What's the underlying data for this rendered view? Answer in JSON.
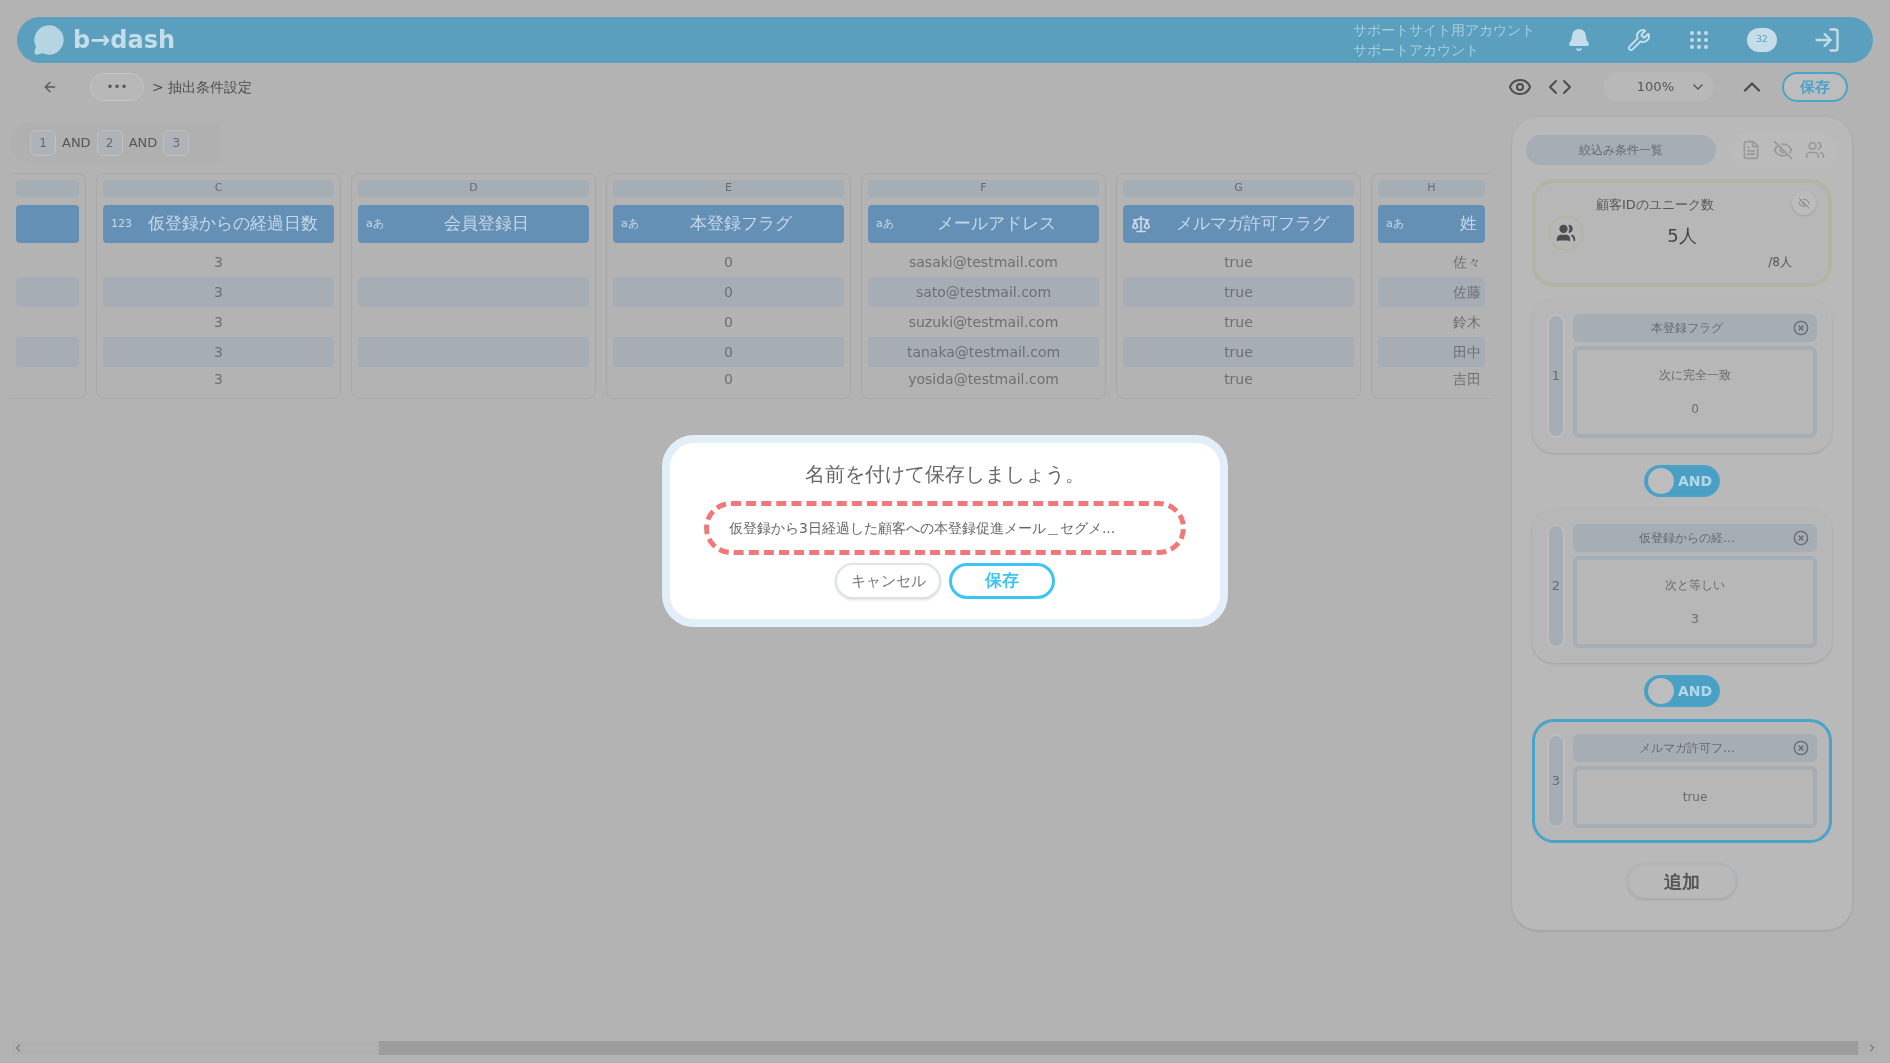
{
  "header": {
    "logo": "b→dash",
    "account_lines": [
      "サポートサイト用アカウント",
      "サポートアカウント"
    ],
    "badge": "32"
  },
  "toolbar": {
    "more": "•••",
    "breadcrumb": "> 抽出条件設定",
    "zoom": "100%",
    "save": "保存"
  },
  "filter_chips": [
    {
      "kind": "number",
      "label": "1"
    },
    {
      "kind": "op",
      "label": "AND"
    },
    {
      "kind": "number",
      "label": "2"
    },
    {
      "kind": "op",
      "label": "AND"
    },
    {
      "kind": "number",
      "label": "3"
    }
  ],
  "columns": [
    {
      "kind": "blank",
      "cells": [
        null,
        null,
        null,
        null,
        null
      ]
    },
    {
      "letter": "C",
      "kind": "number",
      "name": "仮登録からの経過日数",
      "type_label": "123",
      "cells": [
        "3",
        "3",
        "3",
        "3",
        "3"
      ]
    },
    {
      "letter": "D",
      "kind": "text",
      "name": "会員登録日",
      "type_label": "aあ",
      "cells": [
        null,
        null,
        null,
        null,
        null
      ]
    },
    {
      "letter": "E",
      "kind": "text",
      "name": "本登録フラグ",
      "type_label": "aあ",
      "cells": [
        "0",
        "0",
        "0",
        "0",
        "0"
      ]
    },
    {
      "letter": "F",
      "kind": "text",
      "name": "メールアドレス",
      "type_label": "aあ",
      "cells": [
        "sasaki@testmail.com",
        "sato@testmail.com",
        "suzuki@testmail.com",
        "tanaka@testmail.com",
        "yosida@testmail.com"
      ]
    },
    {
      "letter": "G",
      "kind": "boolean",
      "name": "メルマガ許可フラグ",
      "cells": [
        "true",
        "true",
        "true",
        "true",
        "true"
      ]
    },
    {
      "letter": "H",
      "kind": "text",
      "name": "姓",
      "type_label": "aあ",
      "cells": [
        "佐々",
        "佐藤",
        "鈴木",
        "田中",
        "吉田"
      ]
    }
  ],
  "panel": {
    "tab": "絞込み条件一覧",
    "summary": {
      "label": "顧客IDのユニーク数",
      "value": "5人",
      "total": "/8人"
    },
    "conditions": [
      {
        "number": "1",
        "title": "本登録フラグ",
        "operator": "次に完全一致",
        "value": "0",
        "selected": false
      },
      {
        "number": "2",
        "title": "仮登録からの経…",
        "operator": "次と等しい",
        "value": "3",
        "selected": false
      },
      {
        "number": "3",
        "title": "メルマガ許可フ…",
        "value": "true",
        "selected": true
      }
    ],
    "connectors": [
      {
        "label": "AND"
      },
      {
        "label": "AND"
      }
    ],
    "add": "追加"
  },
  "dialog": {
    "title": "名前を付けて保存しましょう。",
    "value": "仮登録から3日経過した顧客への本登録促進メール＿セグメ...",
    "cancel": "キャンセル",
    "save": "保存"
  }
}
